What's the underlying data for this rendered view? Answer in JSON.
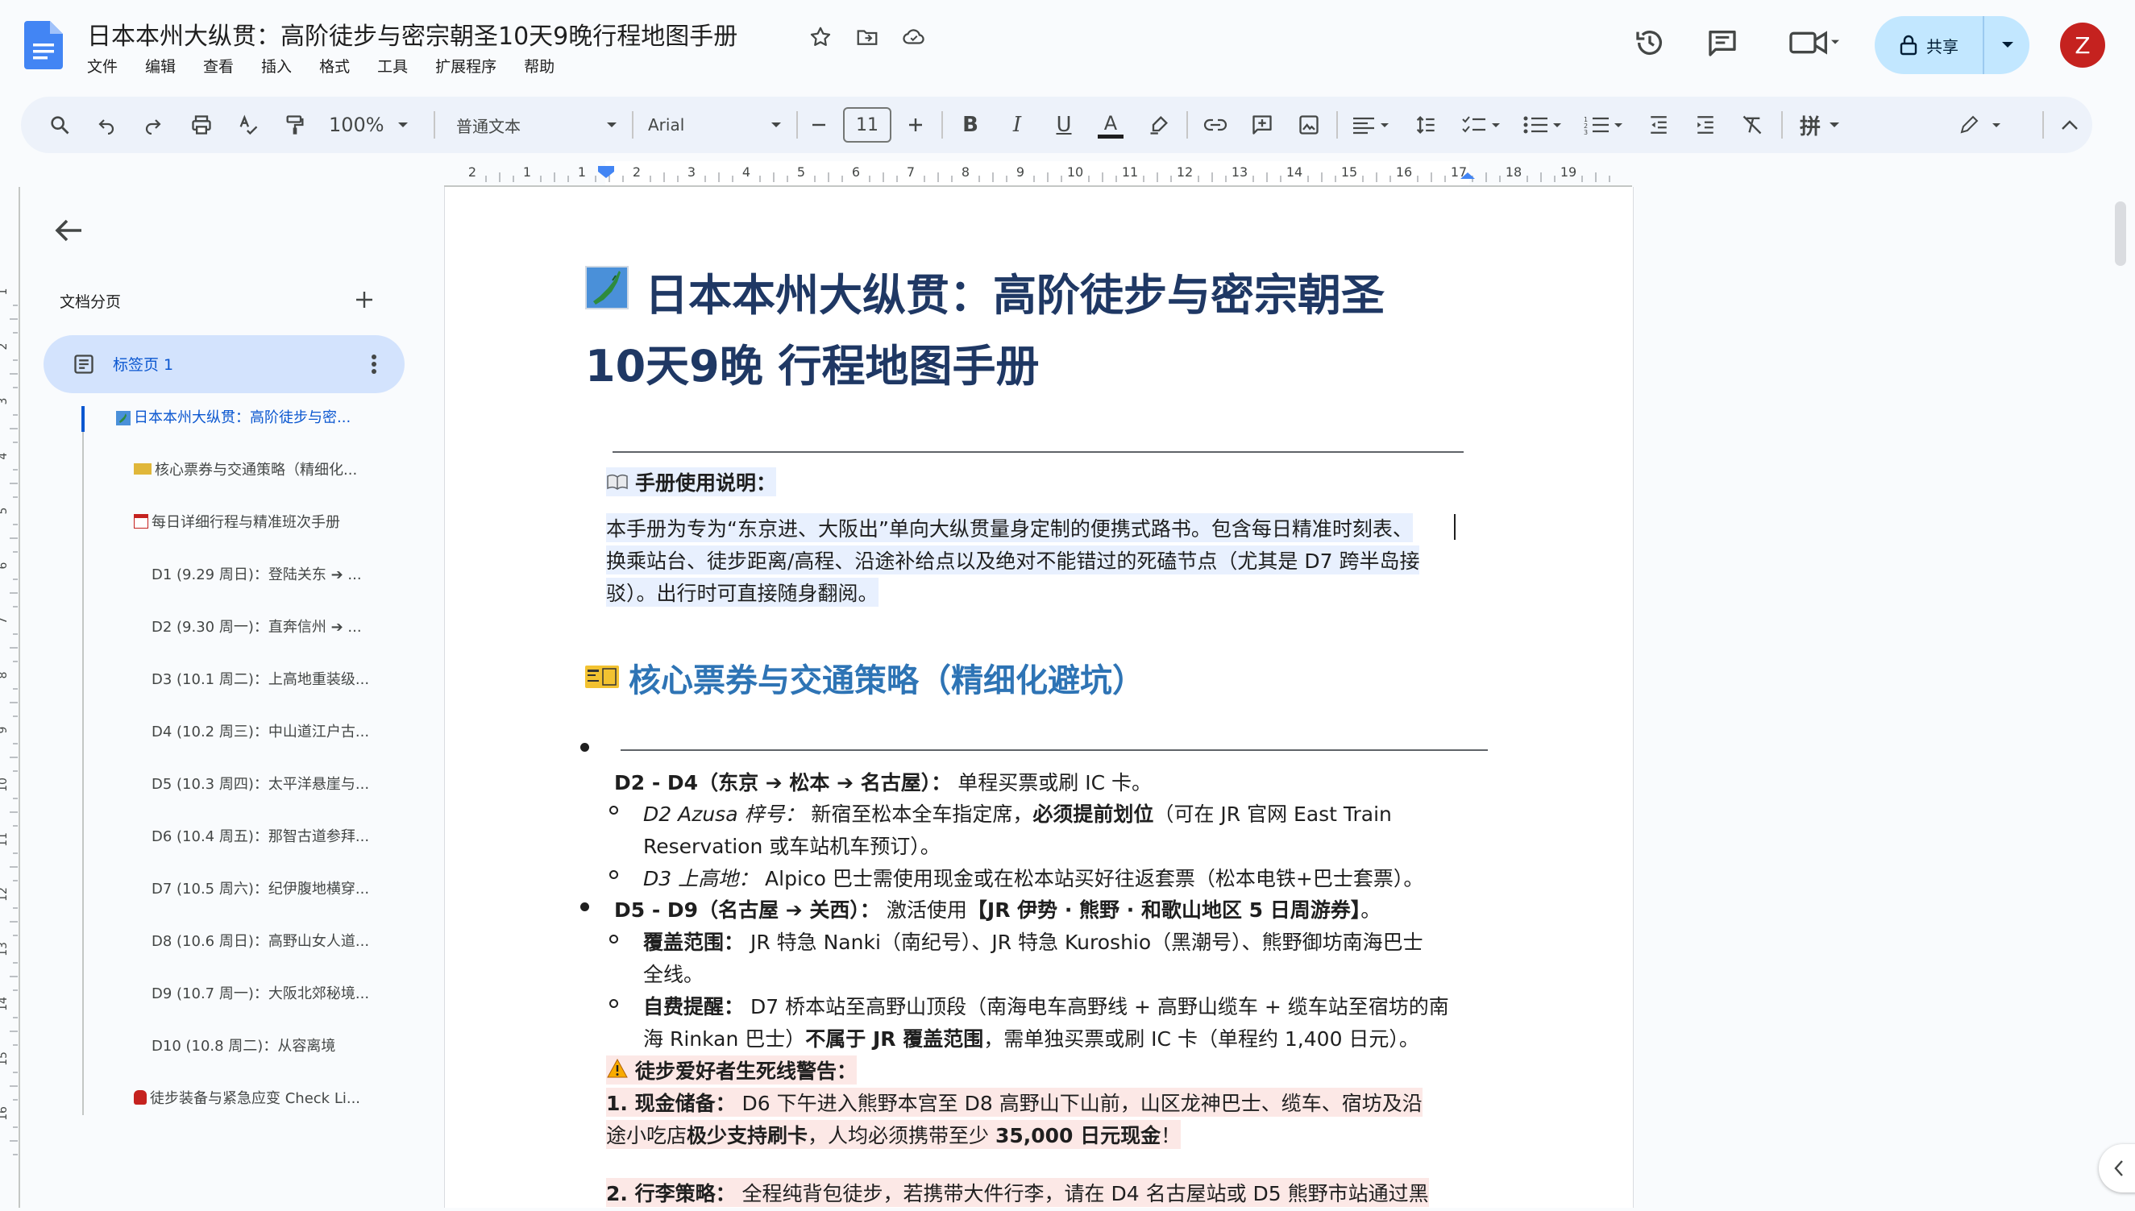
{
  "doc": {
    "title": "日本本州大纵贯：高阶徒步与密宗朝圣10天9晚行程地图手册",
    "menu": [
      "文件",
      "编辑",
      "查看",
      "插入",
      "格式",
      "工具",
      "扩展程序",
      "帮助"
    ]
  },
  "header": {
    "share_label": "共享",
    "avatar_letter": "Z"
  },
  "toolbar": {
    "zoom": "100%",
    "style": "普通文本",
    "font": "Arial",
    "font_size": "11",
    "input_method": "拼"
  },
  "ruler": {
    "ticks": [
      "2",
      "1",
      "1",
      "2",
      "3",
      "4",
      "5",
      "6",
      "7",
      "8",
      "9",
      "10",
      "11",
      "12",
      "13",
      "14",
      "15",
      "16",
      "17",
      "18",
      "19"
    ]
  },
  "vruler": {
    "ticks": [
      "1",
      "2",
      "3",
      "4",
      "5",
      "6",
      "7",
      "8",
      "9",
      "10",
      "11",
      "12",
      "13",
      "14",
      "15",
      "16"
    ]
  },
  "sidebar": {
    "label": "文档分页",
    "tab_name": "标签页 1",
    "outline": [
      "日本本州大纵贯：高阶徒步与密...",
      "核心票券与交通策略（精细化...",
      "每日详细行程与精准班次手册",
      "D1 (9.29 周日)：登陆关东 ➔ ...",
      "D2 (9.30 周一)：直奔信州 ➔ ...",
      "D3 (10.1 周二)：上高地重装级...",
      "D4 (10.2 周三)：中山道江户古...",
      "D5 (10.3 周四)：太平洋悬崖与...",
      "D6 (10.4 周五)：那智古道参拜...",
      "D7 (10.5 周六)：纪伊腹地横穿...",
      "D8 (10.6 周日)：高野山女人道...",
      "D9 (10.7 周一)：大阪北郊秘境...",
      "D10 (10.8 周二)：从容离境",
      "徒步装备与紧急应变 Check Li..."
    ]
  },
  "content": {
    "h1_line1": "日本本州大纵贯：高阶徒步与密宗朝圣",
    "h1_line2": "10天9晚 行程地图手册",
    "notice_title": "手册使用说明：",
    "intro_1": "本手册为专为“东京进、大阪出”单向大纵贯量身定制的便携式路书。包含每日精准时刻表、",
    "intro_2": "换乘站台、徒步距离/高程、沿途补给点以及绝对不能错过的死磕节点（尤其是 D7 跨半岛接",
    "intro_3": "驳）。出行时可直接随身翻阅。",
    "h2": "核心票券与交通策略（精细化避坑）",
    "b1_bold": "D2 - D4（东京 ➔ 松本 ➔ 名古屋）：",
    "b1_rest": " 单程买票或刷 IC 卡。",
    "s1_italic": "D2 Azusa 梓号：",
    "s1_text": " 新宿至松本全车指定席，",
    "s1_bold": "必须提前划位",
    "s1_rest": "（可在 JR 官网 East Train",
    "s1_line2": "Reservation 或车站机车预订）。",
    "s2_italic": "D3 上高地：",
    "s2_text": " Alpico 巴士需使用现金或在松本站买好往返套票（松本电铁+巴士套票）。",
    "b2_bold": "D5 - D9（名古屋 ➔ 关西）：",
    "b2_text": " 激活使用",
    "b2_bold2": "【JR 伊势 · 熊野 · 和歌山地区 5 日周游券】",
    "b2_rest": "。",
    "s3_bold": "覆盖范围：",
    "s3_text": " JR 特急 Nanki（南纪号）、JR 特急 Kuroshio（黑潮号）、熊野御坊南海巴士",
    "s3_line2": "全线。",
    "s4_bold": "自费提醒：",
    "s4_text": " D7 桥本站至高野山顶段（南海电车高野线 + 高野山缆车 + 缆车站至宿坊的南",
    "s4_line2a": "海 Rinkan 巴士）",
    "s4_bold2": "不属于 JR 覆盖范围",
    "s4_line2b": "，需单独买票或刷 IC 卡（单程约 1,400 日元）。",
    "warn_title": "徒步爱好者生死线警告：",
    "w1_bold": "1. 现金储备：",
    "w1_text": " D6 下午进入熊野本宫至 D8 高野山下山前，山区龙神巴士、缆车、宿坊及沿",
    "w1_line2a": "途小吃店",
    "w1_bold2": "极少支持刷卡",
    "w1_line2b": "，人均必须携带至少 ",
    "w1_bold3": "35,000 日元现金",
    "w1_line2c": "！",
    "w2_bold": "2. 行李策略：",
    "w2_text": " 全程纯背包徒步，若携带大件行李，请在 D4 名古屋站或 D5 熊野市站通过黑"
  }
}
